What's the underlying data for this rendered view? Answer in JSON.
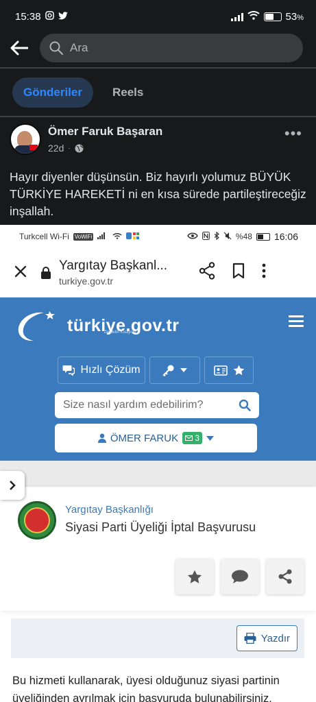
{
  "status_bar": {
    "time": "15:38",
    "battery": "53",
    "battery_suffix": "%"
  },
  "fb_header": {
    "search_placeholder": "Ara"
  },
  "tabs": [
    {
      "label": "Gönderiler",
      "active": true
    },
    {
      "label": "Reels",
      "active": false
    }
  ],
  "post": {
    "author": "Ömer Faruk Başaran",
    "time": "22d",
    "text": "Hayır diyenler düşünsün. Biz hayırlı yolumuz BÜYÜK TÜRKİYE HAREKETİ ni en kısa sürede partileştireceğiz inşallah."
  },
  "screenshot": {
    "status_bar": {
      "carrier": "Turkcell Wi-Fi",
      "vowifi": "VoWiFi",
      "battery": "%48",
      "time": "16:06"
    },
    "chrome": {
      "title": "Yargıtay Başkanl...",
      "url": "turkiye.gov.tr"
    },
    "gov": {
      "logo_text": "türkiye.gov.tr",
      "logo_sub": "\"Devletin Kısayolu\"",
      "quick_label": "Hızlı Çözüm",
      "search_placeholder": "Size nasıl yardım edebilirim?",
      "user_name": "ÖMER FARUK",
      "mail_count": "3"
    },
    "service": {
      "org": "Yargıtay Başkanlığı",
      "name": "Siyasi Parti Üyeliği İptal Başvurusu",
      "print_label": "Yazdır",
      "description": "Bu hizmeti kullanarak, üyesi olduğunuz siyasi partinin üyeliğinden ayrılmak için başvuruda bulunabilirsiniz."
    }
  },
  "colors": {
    "fb_bg": "#18191a",
    "fb_accent": "#2d88ff",
    "gov_blue": "#3a7abd",
    "badge_green": "#33b06a"
  },
  "icons": [
    "instagram-icon",
    "twitter-icon",
    "signal-icon",
    "wifi-icon",
    "battery-icon",
    "back-arrow-icon",
    "search-icon",
    "more-icon",
    "globe-icon",
    "close-icon",
    "lock-icon",
    "share-icon",
    "bookmark-icon",
    "kebab-icon",
    "hamburger-icon",
    "chat-icon",
    "key-icon",
    "id-card-icon",
    "star-icon",
    "user-icon",
    "mail-icon",
    "chevron-right-icon",
    "comment-icon",
    "printer-icon"
  ]
}
